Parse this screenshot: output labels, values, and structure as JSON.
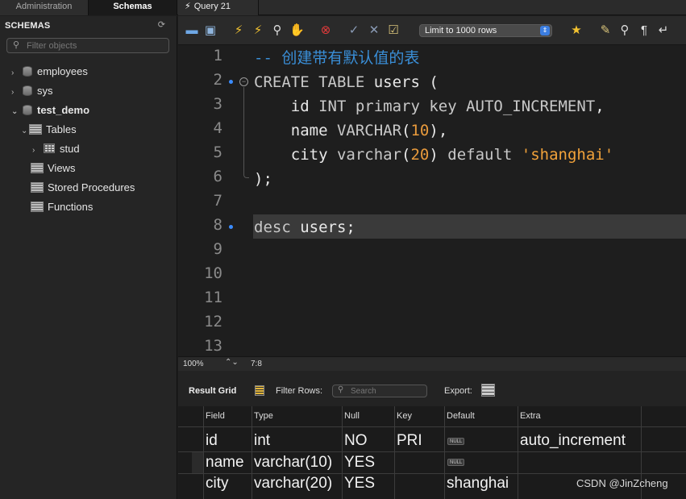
{
  "tabs": {
    "administration": "Administration",
    "schemas": "Schemas",
    "query": "Query 21"
  },
  "sidebar": {
    "title": "SCHEMAS",
    "filter_placeholder": "Filter objects",
    "items": [
      {
        "label": "employees"
      },
      {
        "label": "sys"
      },
      {
        "label": "test_demo"
      },
      {
        "label": "Tables"
      },
      {
        "label": "stud"
      },
      {
        "label": "Views"
      },
      {
        "label": "Stored Procedures"
      },
      {
        "label": "Functions"
      }
    ]
  },
  "toolbar": {
    "limit_label": "Limit to 1000 rows"
  },
  "editor": {
    "line_numbers": [
      "1",
      "2",
      "3",
      "4",
      "5",
      "6",
      "7",
      "8",
      "9",
      "10",
      "11",
      "12",
      "13"
    ]
  },
  "status": {
    "zoom": "100%",
    "cursor": "7:8"
  },
  "result": {
    "grid_label": "Result Grid",
    "filter_rows_label": "Filter Rows:",
    "search_placeholder": "Search",
    "export_label": "Export:",
    "columns": [
      "Field",
      "Type",
      "Null",
      "Key",
      "Default",
      "Extra"
    ],
    "rows": [
      [
        "id",
        "int",
        "NO",
        "PRI",
        "NULL",
        "auto_increment"
      ],
      [
        "name",
        "varchar(10)",
        "YES",
        "",
        "NULL",
        ""
      ],
      [
        "city",
        "varchar(20)",
        "YES",
        "",
        "shanghai",
        ""
      ]
    ]
  },
  "watermark": "CSDN @JinZcheng",
  "colors": {
    "keyword": "#c8c8c8",
    "comment": "#3a8fd8",
    "number": "#e89a3c",
    "string": "#f2a23a",
    "marker": "#3b8cff"
  }
}
